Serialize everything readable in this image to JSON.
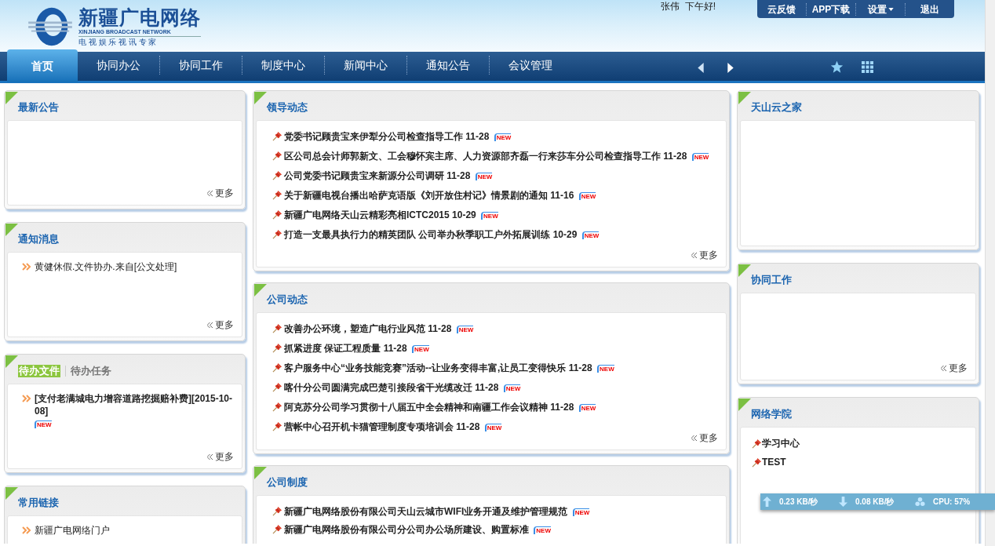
{
  "logo": {
    "name": "新疆广电网络",
    "english": "XINJIANG BROADCAST NETWORK",
    "slogan": "电 视 娱 乐 视 讯 专 家"
  },
  "greeting": "张伟  下午好!",
  "top_links": [
    {
      "label": "云反馈",
      "caret": false
    },
    {
      "label": "APP下载",
      "caret": false
    },
    {
      "label": "设置",
      "caret": true
    },
    {
      "label": "退出",
      "caret": false
    }
  ],
  "nav": [
    {
      "label": "首页",
      "selected": true
    },
    {
      "label": "协同办公",
      "selected": false
    },
    {
      "label": "协同工作",
      "selected": false
    },
    {
      "label": "制度中心",
      "selected": false
    },
    {
      "label": "新闻中心",
      "selected": false
    },
    {
      "label": "通知公告",
      "selected": false
    },
    {
      "label": "会议管理",
      "selected": false
    }
  ],
  "columns": [
    [
      {
        "title": "最新公告",
        "more": "更多"
      },
      {
        "kind": "arrow",
        "title": "通知消息",
        "items": [
          {
            "text": "黄健休假.文件协办.来自[公文处理]",
            "bold": false
          }
        ],
        "more": "更多"
      },
      {
        "kind": "arrow",
        "tabs": [
          {
            "label": "待办文件",
            "selected": true
          },
          {
            "label": "待办任务",
            "selected": false
          }
        ],
        "items": [
          {
            "text": "[支付老满城电力增容道路挖掘赔补费][2015-10-08]",
            "badge": "NEW",
            "bold": true
          }
        ],
        "more": "更多"
      },
      {
        "kind": "arrow",
        "title": "常用链接",
        "items": [
          {
            "text": "新疆广电网络门户",
            "bold": false
          }
        ]
      }
    ],
    [
      {
        "kind": "news",
        "title": "领导动态",
        "items": [
          {
            "text": "党委书记顾贵宝来伊犁分公司检查指导工作",
            "date": "11-28",
            "badge": "NEW"
          },
          {
            "text": "区公司总会计师郭新文、工会穆怀宾主席、人力资源部齐磊一行来莎车分公司检查指导工作",
            "date": "11-28",
            "badge": "NEW"
          },
          {
            "text": "公司党委书记顾贵宝来新源分公司调研",
            "date": "11-28",
            "badge": "NEW"
          },
          {
            "text": "关于新疆电视台播出哈萨克语版《刘开放住村记》情景剧的通知",
            "date": "11-16",
            "badge": "NEW"
          },
          {
            "text": "新疆广电网络天山云精彩亮相ICTC2015",
            "date": "10-29",
            "badge": "NEW"
          },
          {
            "text": "打造一支最具执行力的精英团队 公司举办秋季职工户外拓展训练",
            "date": "10-29",
            "badge": "NEW"
          }
        ],
        "more": "更多"
      },
      {
        "kind": "news",
        "title": "公司动态",
        "items": [
          {
            "text": "改善办公环境，塑造广电行业风范",
            "date": "11-28",
            "badge": "NEW"
          },
          {
            "text": "抓紧进度 保证工程质量",
            "date": "11-28",
            "badge": "NEW"
          },
          {
            "text": "客户服务中心“业务技能竞赛”活动--让业务变得丰富,让员工变得快乐",
            "date": "11-28",
            "badge": "NEW"
          },
          {
            "text": "喀什分公司圆满完成巴楚引接段省干光缆改迁",
            "date": "11-28",
            "badge": "NEW"
          },
          {
            "text": "阿克苏分公司学习贯彻十八届五中全会精神和南疆工作会议精神",
            "date": "11-28",
            "badge": "NEW"
          },
          {
            "text": "营帐中心召开机卡猫管理制度专项培训会",
            "date": "11-28",
            "badge": "NEW"
          }
        ],
        "more": "更多"
      },
      {
        "kind": "news",
        "title": "公司制度",
        "items": [
          {
            "text": "新疆广电网络股份有限公司天山云城市WIFI业务开通及维护管理规范",
            "badge": "NEW"
          },
          {
            "text": "新疆广电网络股份有限公司分公司办公场所建设、购置标准",
            "badge": "NEW"
          }
        ]
      }
    ],
    [
      {
        "title": "天山云之家"
      },
      {
        "title": "协同工作",
        "more": "更多"
      },
      {
        "kind": "pin",
        "title": "网络学院",
        "items": [
          {
            "text": "学习中心"
          },
          {
            "text": "TEST"
          }
        ]
      }
    ]
  ],
  "net_meter": {
    "upload": "0.23 KB/秒",
    "download": "0.08 KB/秒",
    "cpu": "CPU: 57%"
  }
}
